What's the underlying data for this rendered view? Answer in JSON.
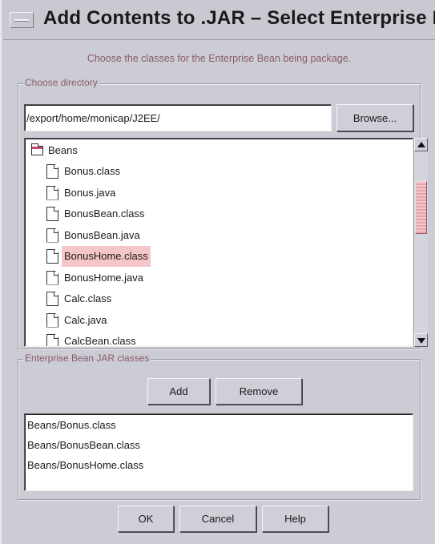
{
  "window": {
    "title": "Add Contents to .JAR – Select Enterprise Bea"
  },
  "instruction": "Choose the classes for the Enterprise Bean being package.",
  "directory_group": {
    "legend": "Choose directory",
    "path_value": "/export/home/monicap/J2EE/",
    "browse_label": "Browse..."
  },
  "tree": {
    "folder": "Beans",
    "files": [
      {
        "label": "Bonus.class",
        "selected": false
      },
      {
        "label": "Bonus.java",
        "selected": false
      },
      {
        "label": "BonusBean.class",
        "selected": false
      },
      {
        "label": "BonusBean.java",
        "selected": false
      },
      {
        "label": "BonusHome.class",
        "selected": true
      },
      {
        "label": "BonusHome.java",
        "selected": false
      },
      {
        "label": "Calc.class",
        "selected": false
      },
      {
        "label": "Calc.java",
        "selected": false
      },
      {
        "label": "CalcBean.class",
        "selected": false
      }
    ]
  },
  "jar_group": {
    "legend": "Enterprise Bean JAR classes",
    "add_label": "Add",
    "remove_label": "Remove",
    "items": [
      "Beans/Bonus.class",
      "Beans/BonusBean.class",
      "Beans/BonusHome.class"
    ]
  },
  "footer": {
    "ok_label": "OK",
    "cancel_label": "Cancel",
    "help_label": "Help"
  },
  "colors": {
    "dialog_bg": "#ccccd4",
    "legend_text": "#8a5a6a",
    "selection_bg": "#f4c6c8",
    "scroll_thumb": "#e6a6ae"
  }
}
